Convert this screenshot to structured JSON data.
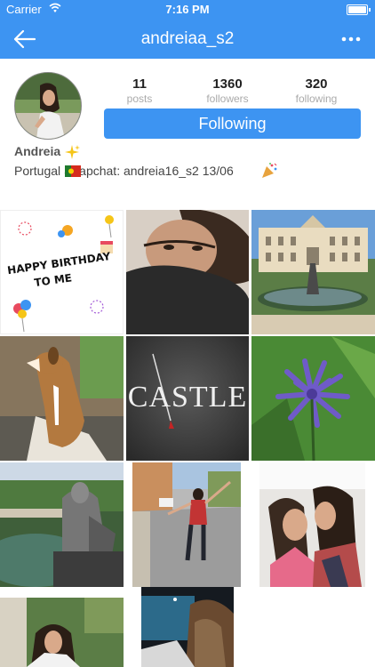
{
  "status_bar": {
    "carrier": "Carrier",
    "time": "7:16 PM"
  },
  "nav": {
    "title": "andreiaa_s2",
    "back_icon": "back-arrow-icon",
    "more_icon": "more-dots-icon"
  },
  "profile": {
    "stats": [
      {
        "value": "11",
        "label": "posts"
      },
      {
        "value": "1360",
        "label": "followers"
      },
      {
        "value": "320",
        "label": "following"
      }
    ],
    "follow_label": "Following",
    "name": "Andreia",
    "bio": "Portugal  Snapchat: andreia16_s2 13/06",
    "accent_color": "#3d94f2"
  },
  "photos": [
    {
      "name": "happy-birthday-post",
      "text_line1": "HAPPY BIRTHDAY",
      "text_line2": "TO ME"
    },
    {
      "name": "selfie-photo"
    },
    {
      "name": "palace-photo"
    },
    {
      "name": "dog-photo"
    },
    {
      "name": "castle-photo",
      "text": "CASTLE"
    },
    {
      "name": "purple-flower-photo"
    },
    {
      "name": "fountain-statue-photo"
    },
    {
      "name": "street-photo"
    },
    {
      "name": "friends-photo"
    },
    {
      "name": "garden-portrait-photo"
    },
    {
      "name": "pool-night-photo"
    }
  ]
}
